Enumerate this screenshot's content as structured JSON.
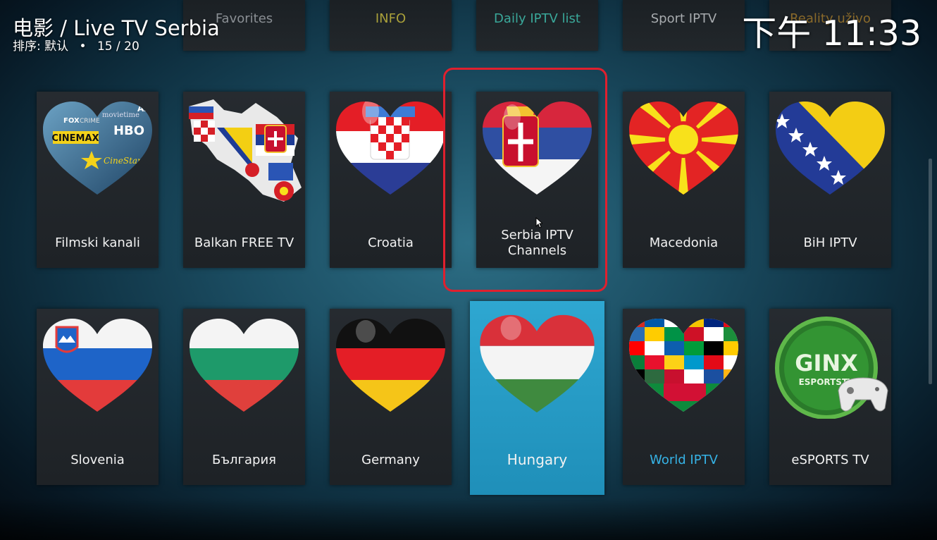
{
  "header": {
    "title": "电影 / Live TV Serbia",
    "sort_label": "排序: 默认",
    "separator": "•",
    "position": "15 / 20",
    "clock": "下午 11:33"
  },
  "top_row": [
    {
      "label": "Favorites",
      "color": "#8a8f94"
    },
    {
      "label": "INFO",
      "color": "#a9a03a"
    },
    {
      "label": "Daily IPTV list",
      "color": "#3aa89a"
    },
    {
      "label": "Sport IPTV",
      "color": "#a7abae"
    },
    {
      "label": "Reality uživo",
      "color": "#8a6a2a"
    }
  ],
  "row1": [
    {
      "label": "Filmski kanali",
      "icon": "movie-channels-heart-icon"
    },
    {
      "label": "Balkan FREE TV",
      "icon": "balkan-map-flags-icon"
    },
    {
      "label": "Croatia",
      "icon": "croatia-heart-icon"
    },
    {
      "label": "Serbia IPTV Channels",
      "icon": "serbia-heart-icon"
    },
    {
      "label": "Macedonia",
      "icon": "macedonia-heart-icon"
    },
    {
      "label": "BiH IPTV",
      "icon": "bosnia-heart-icon"
    }
  ],
  "row2": [
    {
      "label": "Slovenia",
      "icon": "slovenia-heart-icon"
    },
    {
      "label": "България",
      "icon": "bulgaria-heart-icon"
    },
    {
      "label": "Germany",
      "icon": "germany-heart-icon"
    },
    {
      "label": "Hungary",
      "icon": "hungary-heart-icon",
      "focused": true
    },
    {
      "label": "World IPTV",
      "icon": "world-flags-heart-icon"
    },
    {
      "label": "eSPORTS TV",
      "icon": "ginx-esports-icon"
    }
  ],
  "colors": {
    "focus_tile": "#1f8fb9",
    "highlight_border": "#e0202e",
    "world_label": "#36b3e6"
  }
}
